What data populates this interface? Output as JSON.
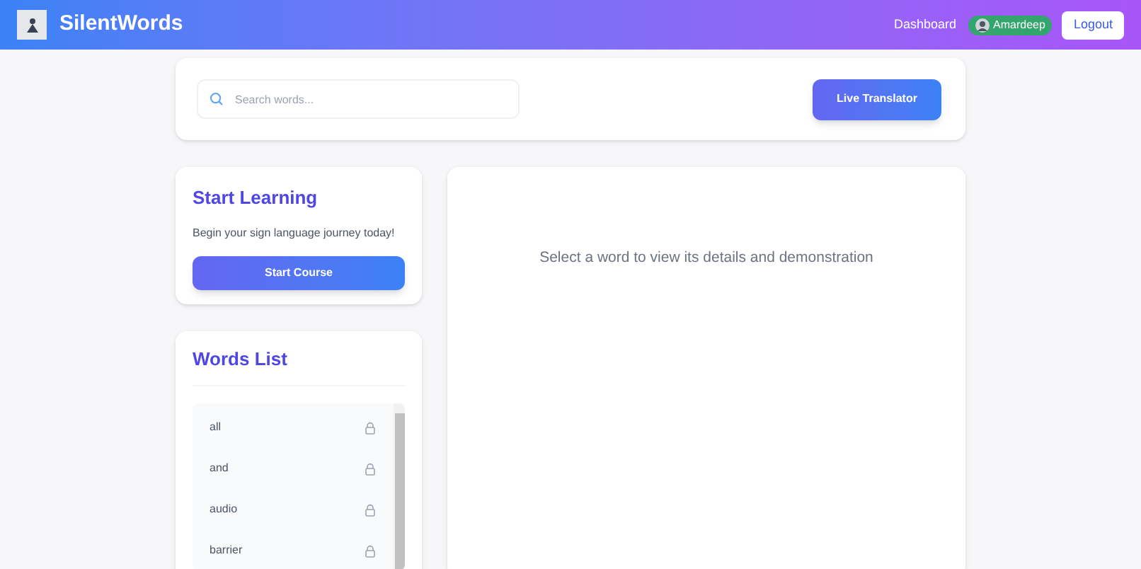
{
  "header": {
    "brand": "SilentWords",
    "nav_link": "Dashboard",
    "user": "Amardeep",
    "logout": "Logout"
  },
  "search": {
    "placeholder": "Search words..."
  },
  "translator_button": "Live Translator",
  "start_card": {
    "title": "Start Learning",
    "text": "Begin your sign language journey today!",
    "button": "Start Course"
  },
  "words_card": {
    "title": "Words List",
    "words": [
      {
        "label": "all",
        "locked": true
      },
      {
        "label": "and",
        "locked": true
      },
      {
        "label": "audio",
        "locked": true
      },
      {
        "label": "barrier",
        "locked": true
      }
    ]
  },
  "detail": {
    "message": "Select a word to view its details and demonstration"
  }
}
